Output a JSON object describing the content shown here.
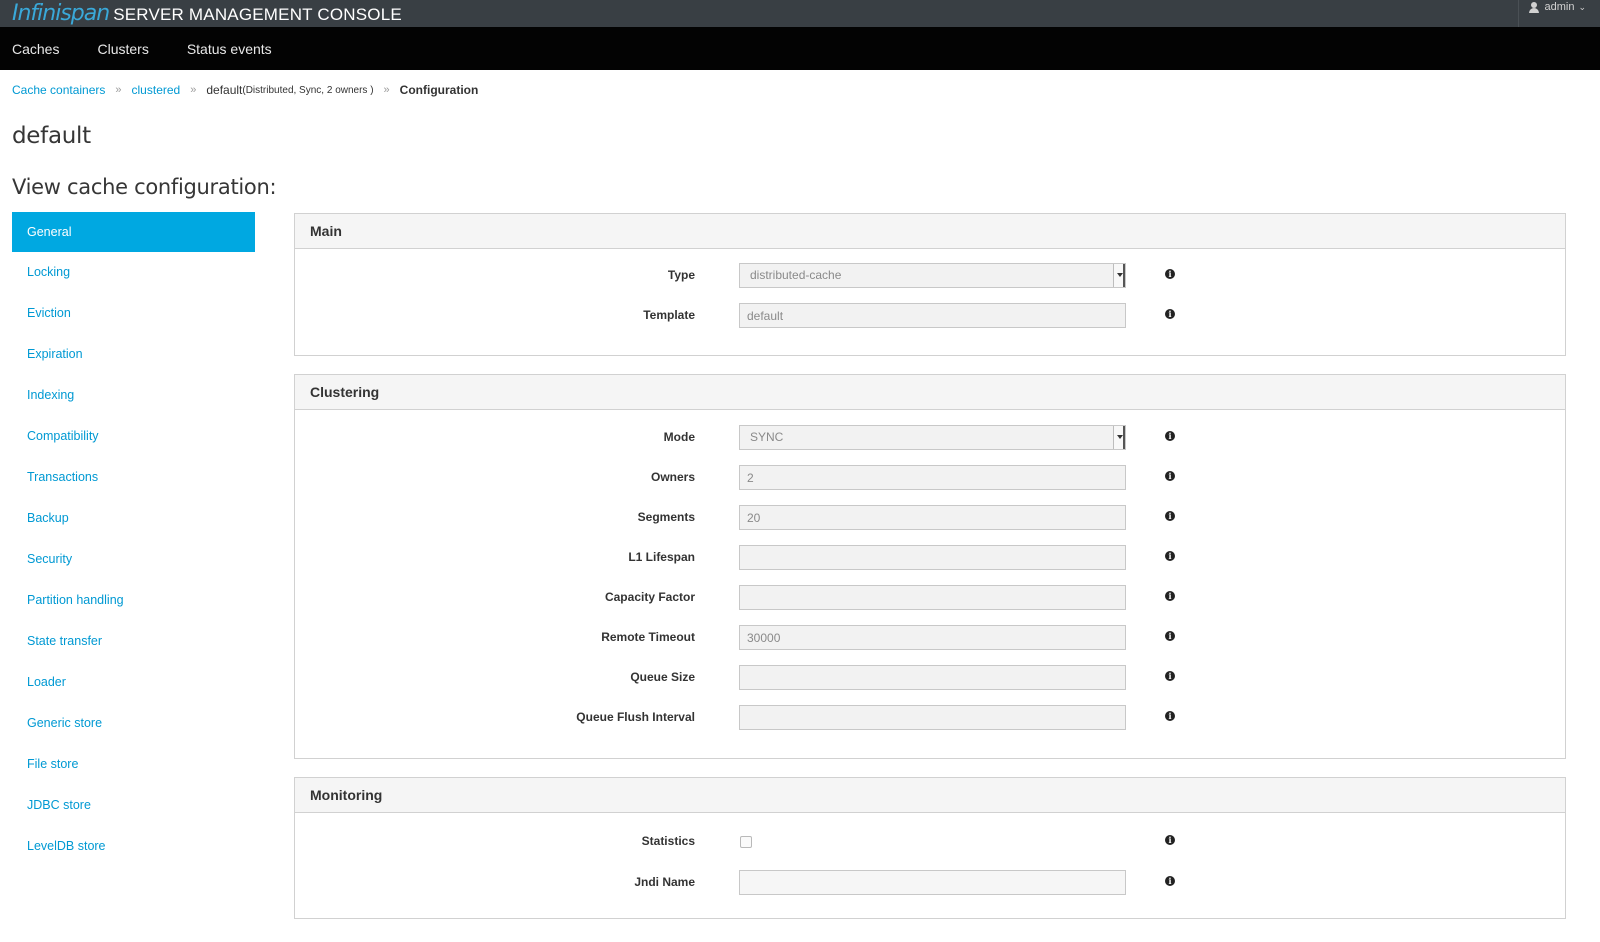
{
  "header": {
    "logo": "Infinispan",
    "title": "SERVER MANAGEMENT CONSOLE",
    "user": "admin"
  },
  "nav": {
    "items": [
      "Caches",
      "Clusters",
      "Status events"
    ]
  },
  "breadcrumb": {
    "cache_containers": "Cache containers",
    "clustered": "clustered",
    "default": "default",
    "default_detail": "(Distributed, Sync, 2 owners )",
    "configuration": "Configuration",
    "separator": "»"
  },
  "page": {
    "title": "default",
    "section_title": "View cache configuration:"
  },
  "sidebar": {
    "items": [
      {
        "label": "General",
        "active": true
      },
      {
        "label": "Locking"
      },
      {
        "label": "Eviction"
      },
      {
        "label": "Expiration"
      },
      {
        "label": "Indexing"
      },
      {
        "label": "Compatibility"
      },
      {
        "label": "Transactions"
      },
      {
        "label": "Backup"
      },
      {
        "label": "Security"
      },
      {
        "label": "Partition handling"
      },
      {
        "label": "State transfer"
      },
      {
        "label": "Loader"
      },
      {
        "label": "Generic store"
      },
      {
        "label": "File store"
      },
      {
        "label": "JDBC store"
      },
      {
        "label": "LevelDB store"
      }
    ]
  },
  "panels": {
    "main": {
      "heading": "Main",
      "type_label": "Type",
      "type_value": "distributed-cache",
      "template_label": "Template",
      "template_value": "default"
    },
    "clustering": {
      "heading": "Clustering",
      "mode_label": "Mode",
      "mode_value": "SYNC",
      "owners_label": "Owners",
      "owners_value": "2",
      "segments_label": "Segments",
      "segments_value": "20",
      "l1_label": "L1 Lifespan",
      "l1_value": "",
      "capacity_label": "Capacity Factor",
      "capacity_value": "",
      "remote_timeout_label": "Remote Timeout",
      "remote_timeout_value": "30000",
      "queue_size_label": "Queue Size",
      "queue_size_value": "",
      "queue_flush_label": "Queue Flush Interval",
      "queue_flush_value": ""
    },
    "monitoring": {
      "heading": "Monitoring",
      "statistics_label": "Statistics",
      "statistics_checked": false,
      "jndi_label": "Jndi Name",
      "jndi_value": ""
    }
  },
  "colors": {
    "accent": "#00a8e1",
    "link": "#0099d3",
    "topbar": "#393f44",
    "navbar": "#030303"
  },
  "icons": {
    "info": "info-circle-icon",
    "user": "user-icon",
    "caret": "chevron-down-icon"
  }
}
